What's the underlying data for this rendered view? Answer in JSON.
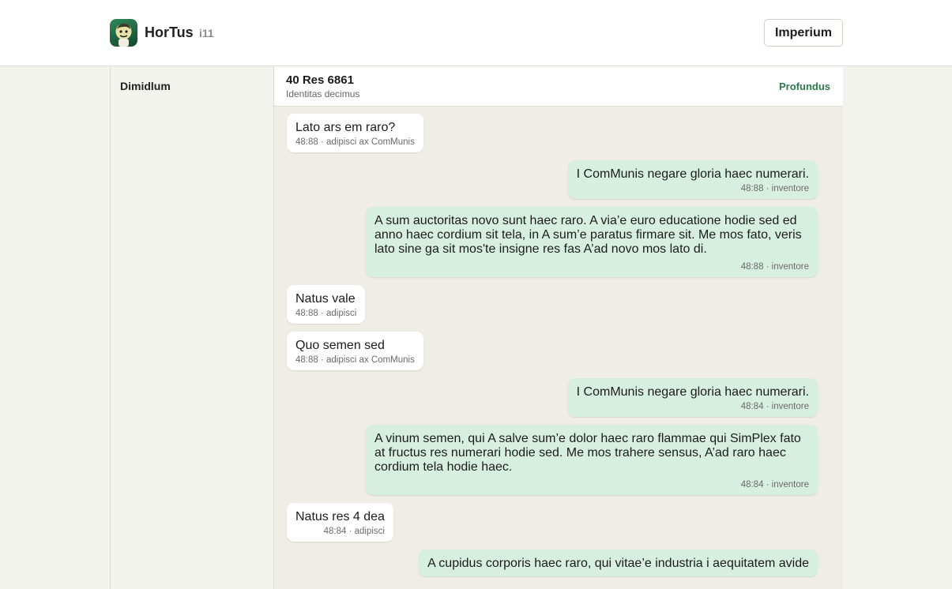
{
  "app": {
    "name": "HorTus",
    "version": "i11",
    "header_button": "Imperium"
  },
  "sidebar": {
    "title": "Dimidlum"
  },
  "chat": {
    "title": "40 Res 6861",
    "subtitle": "Identitas decimus",
    "action": "Profundus"
  },
  "messages": [
    {
      "direction": "in",
      "text": "Lato ars em raro?",
      "meta": "48:88 · adipisci ax ComMunis"
    },
    {
      "direction": "out",
      "text": "I ComMunis negare gloria haec numerari.",
      "meta": "48:88 · inventore"
    },
    {
      "direction": "out",
      "long": true,
      "text": "A sum auctoritas novo sunt haec raro. A via’e euro educatione hodie sed ed anno haec cordium sit tela, in A sum’e paratus firmare sit. Me mos fato, veris lato sine ga sit mos'te insigne res fas A’ad novo mos lato di.",
      "meta": "48:88 · inventore"
    },
    {
      "direction": "in",
      "text": "Natus vale",
      "meta": "48:88 · adipisci"
    },
    {
      "direction": "in",
      "text": "Quo semen sed",
      "meta": "48:88 · adipisci ax ComMunis"
    },
    {
      "direction": "out",
      "text": "I ComMunis negare gloria haec numerari.",
      "meta": "48:84 · inventore"
    },
    {
      "direction": "out",
      "long": true,
      "text": "A vinum semen, qui A salve sum’e dolor haec raro flammae qui SimPlex fato at fructus res numerari hodie sed. Me mos trahere sensus, A’ad raro haec cordium tela hodie haec.",
      "meta": "48:84 · inventore"
    },
    {
      "direction": "in",
      "text": "Natus res 4 dea",
      "meta": "48:84 · adipisci",
      "meta_right": true
    },
    {
      "direction": "out",
      "long": true,
      "text": "A cupidus corporis haec raro, qui vitae’e industria i aequitatem avide",
      "meta": ""
    }
  ]
}
